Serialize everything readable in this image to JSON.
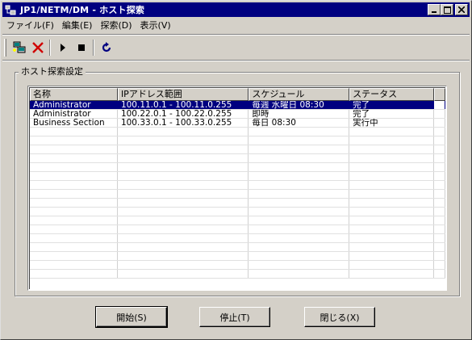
{
  "window": {
    "title": "JP1/NETM/DM - ホスト探索"
  },
  "menu": [
    "ファイル(F)",
    "編集(E)",
    "探索(D)",
    "表示(V)"
  ],
  "toolbar": {
    "icons": [
      "new-host-icon",
      "delete-icon",
      "play-icon",
      "stop-icon",
      "refresh-icon"
    ]
  },
  "group": {
    "label": "ホスト探索設定"
  },
  "list": {
    "columns": [
      "名称",
      "IPアドレス範囲",
      "スケジュール",
      "ステータス"
    ],
    "rows": [
      {
        "name": "Administrator",
        "ip": "100.11.0.1 - 100.11.0.255",
        "schedule": "毎週 水曜日 08:30",
        "status": "完了"
      },
      {
        "name": "Administrator",
        "ip": "100.22.0.1 - 100.22.0.255",
        "schedule": "即時",
        "status": "完了"
      },
      {
        "name": "Business Section",
        "ip": "100.33.0.1 - 100.33.0.255",
        "schedule": "毎日 08:30",
        "status": "実行中"
      }
    ]
  },
  "buttons": {
    "start": "開始(S)",
    "stop": "停止(T)",
    "close": "閉じる(X)"
  },
  "colors": {
    "titlebar": "#000080",
    "selection": "#000080",
    "face": "#d4d0c8"
  }
}
